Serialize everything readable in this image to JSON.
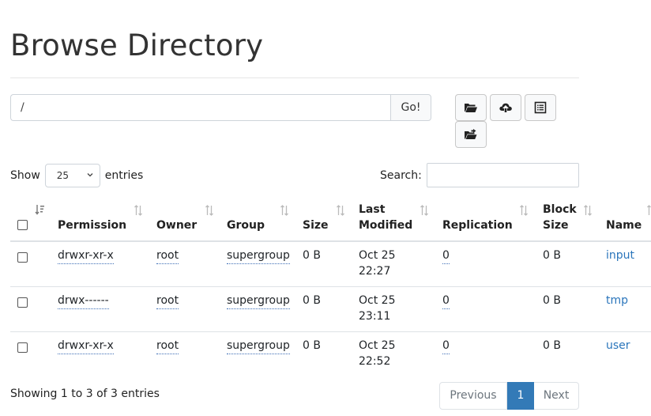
{
  "page": {
    "title": "Browse Directory"
  },
  "path": {
    "value": "/",
    "go_label": "Go!"
  },
  "toolbar": {
    "open_icon": "folder-open-icon",
    "upload_icon": "cloud-upload-icon",
    "list_icon": "list-alt-icon",
    "move_icon": "folder-move-icon"
  },
  "controls": {
    "show_label": "Show",
    "entries_value": "25",
    "entries_label": "entries",
    "search_label": "Search:"
  },
  "table": {
    "headers": {
      "permission": "Permission",
      "owner": "Owner",
      "group": "Group",
      "size": "Size",
      "last_modified_1": "Last",
      "last_modified_2": "Modified",
      "replication": "Replication",
      "block_size_1": "Block",
      "block_size_2": "Size",
      "name": "Name"
    },
    "rows": [
      {
        "permission": "drwxr-xr-x",
        "owner": "root",
        "group": "supergroup",
        "size": "0 B",
        "date": "Oct 25",
        "time": "22:27",
        "replication": "0",
        "block_size": "0 B",
        "name": "input"
      },
      {
        "permission": "drwx------",
        "owner": "root",
        "group": "supergroup",
        "size": "0 B",
        "date": "Oct 25",
        "time": "23:11",
        "replication": "0",
        "block_size": "0 B",
        "name": "tmp"
      },
      {
        "permission": "drwxr-xr-x",
        "owner": "root",
        "group": "supergroup",
        "size": "0 B",
        "date": "Oct 25",
        "time": "22:52",
        "replication": "0",
        "block_size": "0 B",
        "name": "user"
      }
    ]
  },
  "footer": {
    "info": "Showing 1 to 3 of 3 entries",
    "previous": "Previous",
    "current_page": "1",
    "next": "Next"
  },
  "colors": {
    "accent": "#337ab7",
    "link": "#2a75bb"
  }
}
